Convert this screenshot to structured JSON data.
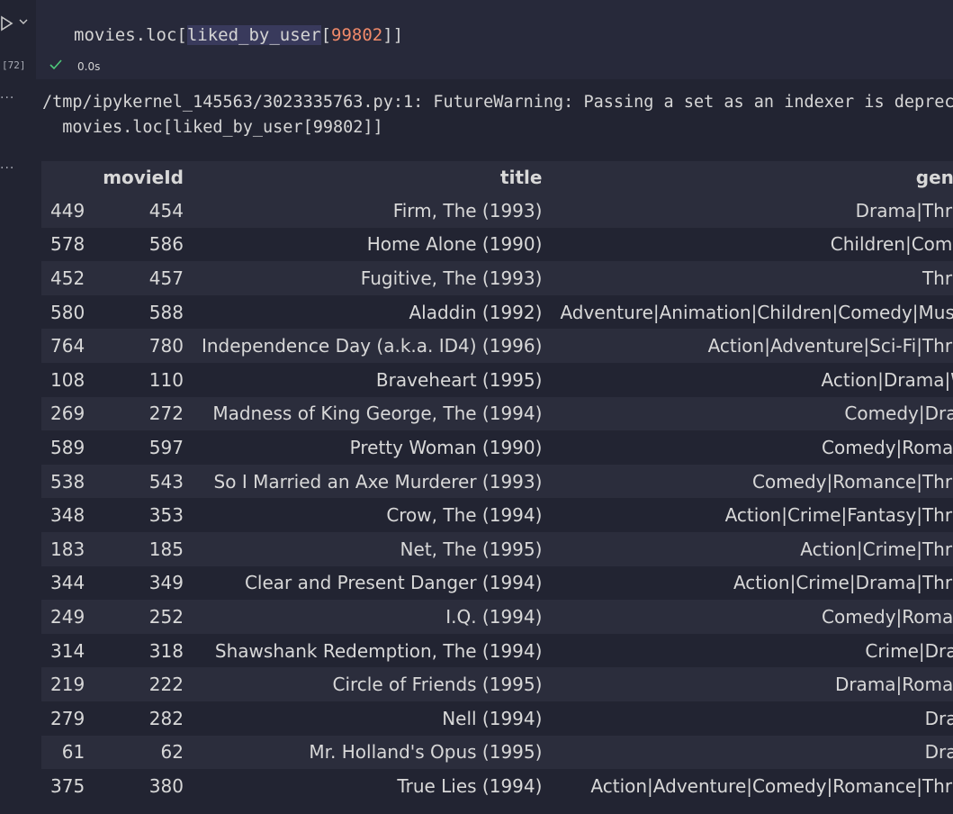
{
  "cell": {
    "exec_count": "[72]",
    "code_prefix": "movies.loc[",
    "code_highlight": "liked_by_user",
    "code_bracket_open": "[",
    "code_number": "99802",
    "code_suffix": "]]",
    "status_time": "0.0s",
    "ellipsis": "..."
  },
  "output": {
    "warning_line1": "/tmp/ipykernel_145563/3023335763.py:1: FutureWarning: Passing a set as an indexer is deprecated",
    "warning_line2": "  movies.loc[liked_by_user[99802]]"
  },
  "table": {
    "columns": [
      "",
      "movieId",
      "title",
      "genres"
    ],
    "rows": [
      {
        "idx": "449",
        "movieId": "454",
        "title": "Firm, The (1993)",
        "genres": "Drama|Thriller"
      },
      {
        "idx": "578",
        "movieId": "586",
        "title": "Home Alone (1990)",
        "genres": "Children|Comedy"
      },
      {
        "idx": "452",
        "movieId": "457",
        "title": "Fugitive, The (1993)",
        "genres": "Thriller"
      },
      {
        "idx": "580",
        "movieId": "588",
        "title": "Aladdin (1992)",
        "genres": "Adventure|Animation|Children|Comedy|Musical"
      },
      {
        "idx": "764",
        "movieId": "780",
        "title": "Independence Day (a.k.a. ID4) (1996)",
        "genres": "Action|Adventure|Sci-Fi|Thriller"
      },
      {
        "idx": "108",
        "movieId": "110",
        "title": "Braveheart (1995)",
        "genres": "Action|Drama|War"
      },
      {
        "idx": "269",
        "movieId": "272",
        "title": "Madness of King George, The (1994)",
        "genres": "Comedy|Drama"
      },
      {
        "idx": "589",
        "movieId": "597",
        "title": "Pretty Woman (1990)",
        "genres": "Comedy|Romance"
      },
      {
        "idx": "538",
        "movieId": "543",
        "title": "So I Married an Axe Murderer (1993)",
        "genres": "Comedy|Romance|Thriller"
      },
      {
        "idx": "348",
        "movieId": "353",
        "title": "Crow, The (1994)",
        "genres": "Action|Crime|Fantasy|Thriller"
      },
      {
        "idx": "183",
        "movieId": "185",
        "title": "Net, The (1995)",
        "genres": "Action|Crime|Thriller"
      },
      {
        "idx": "344",
        "movieId": "349",
        "title": "Clear and Present Danger (1994)",
        "genres": "Action|Crime|Drama|Thriller"
      },
      {
        "idx": "249",
        "movieId": "252",
        "title": "I.Q. (1994)",
        "genres": "Comedy|Romance"
      },
      {
        "idx": "314",
        "movieId": "318",
        "title": "Shawshank Redemption, The (1994)",
        "genres": "Crime|Drama"
      },
      {
        "idx": "219",
        "movieId": "222",
        "title": "Circle of Friends (1995)",
        "genres": "Drama|Romance"
      },
      {
        "idx": "279",
        "movieId": "282",
        "title": "Nell (1994)",
        "genres": "Drama"
      },
      {
        "idx": "61",
        "movieId": "62",
        "title": "Mr. Holland's Opus (1995)",
        "genres": "Drama"
      },
      {
        "idx": "375",
        "movieId": "380",
        "title": "True Lies (1994)",
        "genres": "Action|Adventure|Comedy|Romance|Thriller"
      }
    ]
  },
  "colors": {
    "background": "#222432",
    "cell_background": "#27293a",
    "row_stripe": "#2b2d3c",
    "number_literal": "#f08a6a",
    "success_check": "#4ec97b"
  }
}
